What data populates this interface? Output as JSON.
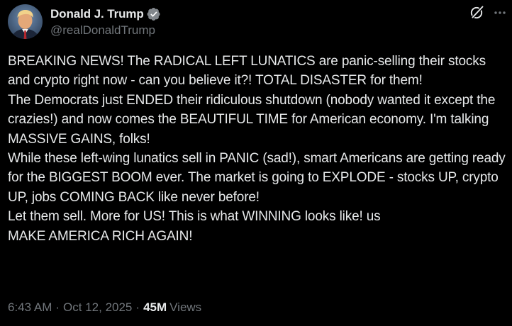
{
  "author": {
    "display_name": "Donald J. Trump",
    "handle": "@realDonaldTrump",
    "verified_icon": "verified-badge-icon",
    "avatar_icon": "avatar"
  },
  "actions": {
    "grok_icon": "grok-icon",
    "more_icon": "more-options-icon"
  },
  "post": {
    "paragraphs": [
      "BREAKING NEWS! The RADICAL LEFT LUNATICS are panic-selling their stocks and crypto right now - can you believe it?! TOTAL DISASTER for them!",
      "The Democrats just ENDED their ridiculous shutdown (nobody wanted it except the crazies!) and now comes the BEAUTIFUL TIME for American economy. I'm talking MASSIVE GAINS, folks!",
      "While these left-wing lunatics sell in PANIC (sad!), smart Americans are getting ready for the BIGGEST BOOM ever. The market is going to EXPLODE - stocks UP, crypto UP, jobs COMING BACK like never before!",
      "Let them sell. More for US! This is what WINNING looks like! us",
      "MAKE AMERICA RICH AGAIN!"
    ]
  },
  "meta": {
    "time": "6:43 AM",
    "separator": "·",
    "date": "Oct 12, 2025",
    "views_count": "45M",
    "views_label": "Views"
  },
  "colors": {
    "background": "#000000",
    "primary_text": "#e7e9ea",
    "secondary_text": "#71767b",
    "verified_blue": "#1d9bf0"
  }
}
